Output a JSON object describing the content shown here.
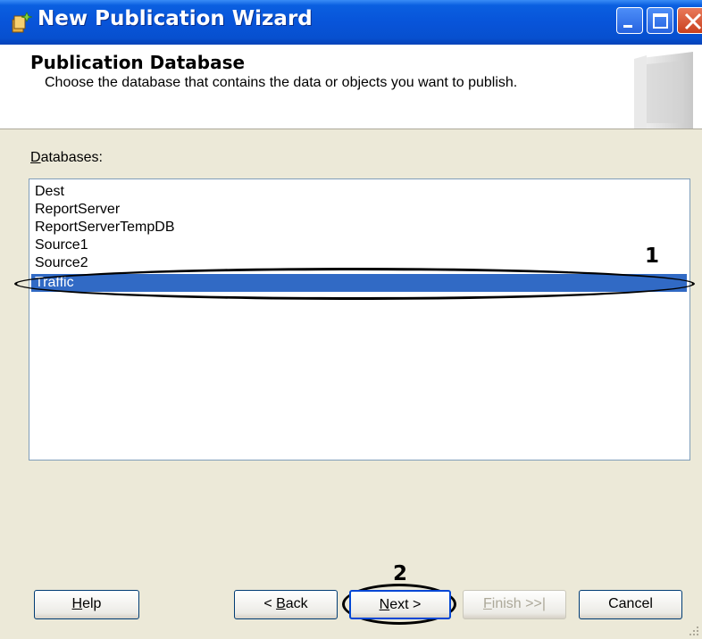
{
  "window": {
    "title": "New Publication Wizard"
  },
  "header": {
    "title": "Publication Database",
    "subtitle": "Choose the database that contains the data or objects you want to publish."
  },
  "databases": {
    "label_mnemonic": "D",
    "label_rest": "atabases:",
    "items": [
      "Dest",
      "ReportServer",
      "ReportServerTempDB",
      "Source1",
      "Source2",
      "Traffic"
    ],
    "selected": "Traffic"
  },
  "callouts": {
    "first": "1",
    "second": "2"
  },
  "buttons": {
    "help": {
      "mnemonic": "H",
      "rest": "elp"
    },
    "back": {
      "prefix": "< ",
      "mnemonic": "B",
      "rest": "ack"
    },
    "next": {
      "mnemonic": "N",
      "rest": "ext >"
    },
    "finish": {
      "mnemonic": "F",
      "rest": "inish >>|"
    },
    "cancel": {
      "label": "Cancel"
    }
  },
  "icons": {
    "app": "wizard-app-icon",
    "minimize": "minimize-icon",
    "maximize": "maximize-icon",
    "close": "close-icon",
    "header": "database-icon"
  },
  "colors": {
    "titlebar": "#0854d9",
    "selection": "#316ac5",
    "dialog": "#ece9d8"
  }
}
